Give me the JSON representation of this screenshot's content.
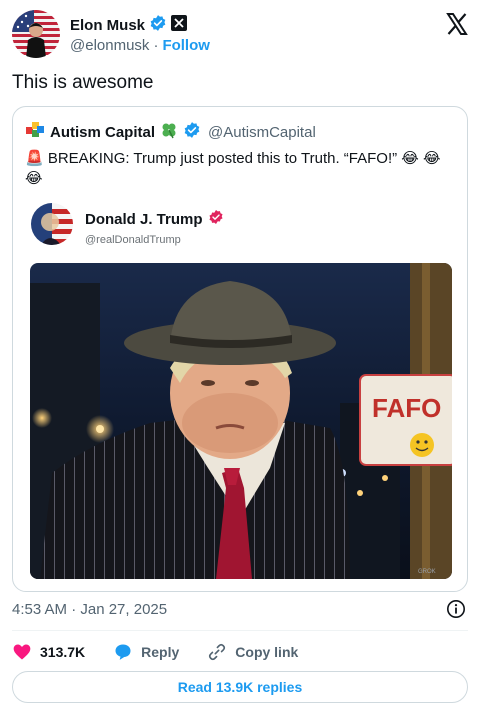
{
  "author": {
    "display_name": "Elon Musk",
    "handle": "@elonmusk",
    "separator": "·",
    "follow_label": "Follow",
    "verified_color": "#1d9bf0"
  },
  "tweet_text": "This is awesome",
  "quote": {
    "display_name": "Autism Capital",
    "handle": "@AutismCapital",
    "text": "🚨 BREAKING: Trump just posted this to Truth. “FAFO!” 😂 😂 😂",
    "embedded": {
      "display_name": "Donald J. Trump",
      "handle": "@realDonaldTrump",
      "verified_color": "#e0245e"
    },
    "image": {
      "sign_text": "FAFO",
      "watermark": "GROK"
    }
  },
  "timestamp": "4:53 AM · Jan 27, 2025",
  "actions": {
    "likes": "313.7K",
    "reply_label": "Reply",
    "copy_link_label": "Copy link"
  },
  "read_replies_label": "Read 13.9K replies",
  "colors": {
    "accent": "#1d9bf0",
    "like": "#f91880",
    "muted": "#536471",
    "border": "#cfd9de"
  },
  "icons": [
    "verified-badge-icon",
    "x-logo-icon",
    "info-icon",
    "heart-icon",
    "reply-bubble-icon",
    "link-icon",
    "clover-icon",
    "puzzle-icon"
  ]
}
